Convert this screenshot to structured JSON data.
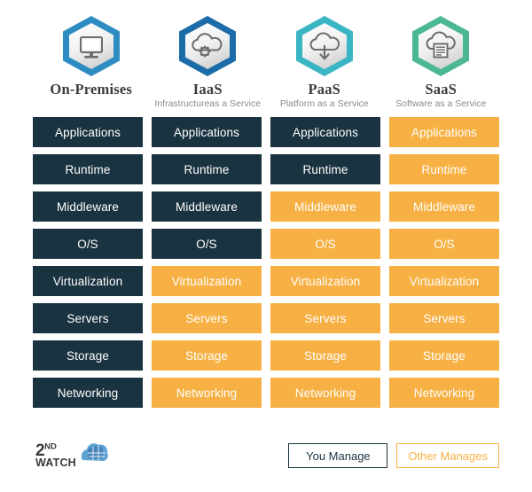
{
  "colors": {
    "you_manage": "#1a3340",
    "other_manages": "#f7b043",
    "onprem_hex": "#2d8dc2",
    "iaas_hex": "#1b6ca8",
    "paas_hex": "#3ab5c4",
    "saas_hex": "#4cb793",
    "title_text": "#3b3b3b",
    "subtitle_text": "#8a8a8a"
  },
  "columns": [
    {
      "id": "on-premises",
      "title": "On-Premises",
      "subtitle": "",
      "icon": "desktop-monitor-icon",
      "hex_color": "#2d8dc2"
    },
    {
      "id": "iaas",
      "title": "IaaS",
      "subtitle": "Infrastructureas a Service",
      "icon": "cloud-gear-icon",
      "hex_color": "#1b6ca8"
    },
    {
      "id": "paas",
      "title": "PaaS",
      "subtitle": "Platform as a Service",
      "icon": "cloud-download-arrow-icon",
      "hex_color": "#3ab5c4"
    },
    {
      "id": "saas",
      "title": "SaaS",
      "subtitle": "Software as a Service",
      "icon": "cloud-document-icon",
      "hex_color": "#4cb793"
    }
  ],
  "rows": [
    {
      "label": "Applications",
      "cells": [
        {
          "label": "Applications",
          "owner": "you"
        },
        {
          "label": "Applications",
          "owner": "you"
        },
        {
          "label": "Applications",
          "owner": "you"
        },
        {
          "label": "Applications",
          "owner": "other"
        }
      ]
    },
    {
      "label": "Runtime",
      "cells": [
        {
          "label": "Runtime",
          "owner": "you"
        },
        {
          "label": "Runtime",
          "owner": "you"
        },
        {
          "label": "Runtime",
          "owner": "you"
        },
        {
          "label": "Runtime",
          "owner": "other"
        }
      ]
    },
    {
      "label": "Middleware",
      "cells": [
        {
          "label": "Middleware",
          "owner": "you"
        },
        {
          "label": "Middleware",
          "owner": "you"
        },
        {
          "label": "Middleware",
          "owner": "other"
        },
        {
          "label": "Middleware",
          "owner": "other"
        }
      ]
    },
    {
      "label": "O/S",
      "cells": [
        {
          "label": "O/S",
          "owner": "you"
        },
        {
          "label": "O/S",
          "owner": "you"
        },
        {
          "label": "O/S",
          "owner": "other"
        },
        {
          "label": "O/S",
          "owner": "other"
        }
      ]
    },
    {
      "label": "Virtualization",
      "cells": [
        {
          "label": "Virtualization",
          "owner": "you"
        },
        {
          "label": "Virtualization",
          "owner": "other"
        },
        {
          "label": "Virtualization",
          "owner": "other"
        },
        {
          "label": "Virtualization",
          "owner": "other"
        }
      ]
    },
    {
      "label": "Servers",
      "cells": [
        {
          "label": "Servers",
          "owner": "you"
        },
        {
          "label": "Servers",
          "owner": "other"
        },
        {
          "label": "Servers",
          "owner": "other"
        },
        {
          "label": "Servers",
          "owner": "other"
        }
      ]
    },
    {
      "label": "Storage",
      "cells": [
        {
          "label": "Storage",
          "owner": "you"
        },
        {
          "label": "Storage",
          "owner": "other"
        },
        {
          "label": "Storage",
          "owner": "other"
        },
        {
          "label": "Storage",
          "owner": "other"
        }
      ]
    },
    {
      "label": "Networking",
      "cells": [
        {
          "label": "Networking",
          "owner": "you"
        },
        {
          "label": "Networking",
          "owner": "other"
        },
        {
          "label": "Networking",
          "owner": "other"
        },
        {
          "label": "Networking",
          "owner": "other"
        }
      ]
    }
  ],
  "legend": {
    "you_manage": "You Manage",
    "other_manages": "Other Manages"
  },
  "logo": {
    "line1": "2",
    "line1_sup": "ND",
    "line2": "WATCH",
    "mark": "globe-cloud-icon"
  }
}
